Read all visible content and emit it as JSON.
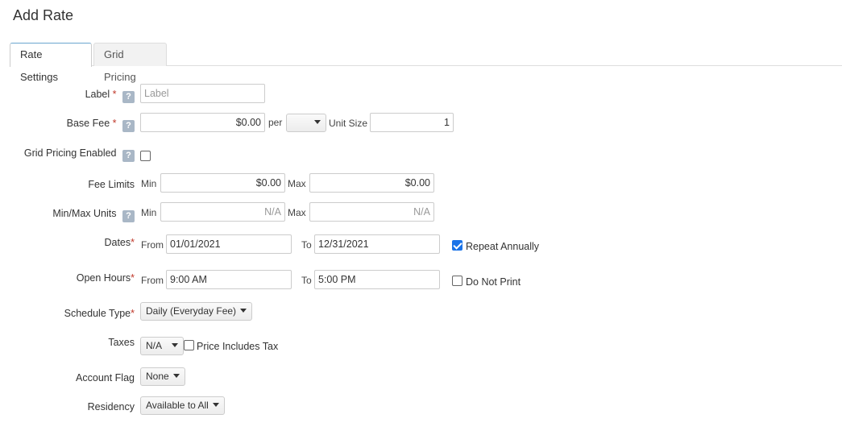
{
  "page_title": "Add Rate",
  "tabs": [
    {
      "label": "Rate Settings",
      "active": true
    },
    {
      "label": "Grid Pricing",
      "active": false
    }
  ],
  "fields": {
    "label": {
      "label": "Label",
      "placeholder": "Label",
      "value": ""
    },
    "base_fee": {
      "label": "Base Fee",
      "value": "$0.00",
      "per": "per",
      "per_select": "",
      "unit_size_label": "Unit Size",
      "unit_size_value": "1"
    },
    "grid_pricing": {
      "label": "Grid Pricing Enabled",
      "checked": false
    },
    "fee_limits": {
      "label": "Fee Limits",
      "min_label": "Min",
      "min_value": "$0.00",
      "max_label": "Max",
      "max_value": "$0.00"
    },
    "minmax_units": {
      "label": "Min/Max Units",
      "min_label": "Min",
      "min_placeholder": "N/A",
      "max_label": "Max",
      "max_placeholder": "N/A"
    },
    "dates": {
      "label": "Dates",
      "from_label": "From",
      "from_value": "01/01/2021",
      "to_label": "To",
      "to_value": "12/31/2021",
      "repeat_label": "Repeat Annually",
      "repeat_checked": true
    },
    "open_hours": {
      "label": "Open Hours",
      "from_label": "From",
      "from_value": "9:00 AM",
      "to_label": "To",
      "to_value": "5:00 PM",
      "dnp_label": "Do Not Print",
      "dnp_checked": false
    },
    "schedule_type": {
      "label": "Schedule Type",
      "value": "Daily (Everyday Fee)"
    },
    "taxes": {
      "label": "Taxes",
      "value": "N/A",
      "price_incl_label": "Price Includes Tax",
      "price_incl_checked": false
    },
    "account_flag": {
      "label": "Account Flag",
      "value": "None"
    },
    "residency": {
      "label": "Residency",
      "value": "Available to All"
    }
  },
  "help_glyph": "?",
  "required_mark": "*",
  "colors": {
    "required": "#c0392b",
    "help_bg": "#a9b7c6",
    "tab_active_border": "#6aa6cf",
    "checkbox_checked": "#1a73e8"
  }
}
